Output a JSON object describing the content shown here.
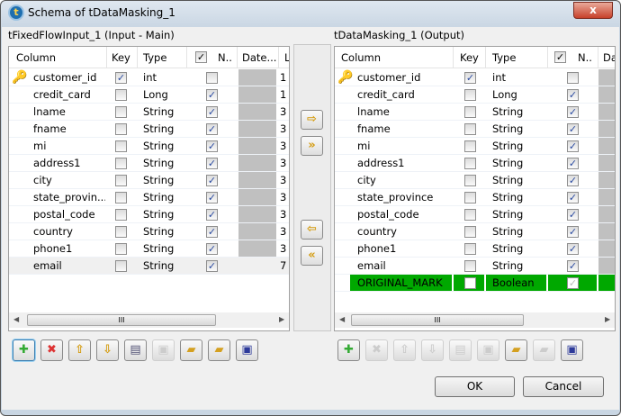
{
  "window": {
    "title": "Schema of tDataMasking_1",
    "close": "x"
  },
  "input": {
    "label": "tFixedFlowInput_1 (Input - Main)",
    "headers": {
      "column": "Column",
      "key": "Key",
      "type": "Type",
      "nullable": "N..",
      "date": "Date...",
      "length": "L"
    },
    "rows": [
      {
        "name": "customer_id",
        "key": true,
        "type": "int",
        "nullable": false,
        "length": "1"
      },
      {
        "name": "credit_card",
        "key": false,
        "type": "Long",
        "nullable": true,
        "length": "1"
      },
      {
        "name": "lname",
        "key": false,
        "type": "String",
        "nullable": true,
        "length": "3"
      },
      {
        "name": "fname",
        "key": false,
        "type": "String",
        "nullable": true,
        "length": "3"
      },
      {
        "name": "mi",
        "key": false,
        "type": "String",
        "nullable": true,
        "length": "3"
      },
      {
        "name": "address1",
        "key": false,
        "type": "String",
        "nullable": true,
        "length": "3"
      },
      {
        "name": "city",
        "key": false,
        "type": "String",
        "nullable": true,
        "length": "3"
      },
      {
        "name": "state_provin...",
        "key": false,
        "type": "String",
        "nullable": true,
        "length": "3"
      },
      {
        "name": "postal_code",
        "key": false,
        "type": "String",
        "nullable": true,
        "length": "3"
      },
      {
        "name": "country",
        "key": false,
        "type": "String",
        "nullable": true,
        "length": "3"
      },
      {
        "name": "phone1",
        "key": false,
        "type": "String",
        "nullable": true,
        "length": "3"
      },
      {
        "name": "email",
        "key": false,
        "type": "String",
        "nullable": true,
        "length": "7",
        "selected": true
      }
    ]
  },
  "output": {
    "label": "tDataMasking_1 (Output)",
    "headers": {
      "column": "Column",
      "key": "Key",
      "type": "Type",
      "nullable": "N..",
      "date": "Da"
    },
    "rows": [
      {
        "name": "customer_id",
        "key": true,
        "type": "int",
        "nullable": false
      },
      {
        "name": "credit_card",
        "key": false,
        "type": "Long",
        "nullable": true
      },
      {
        "name": "lname",
        "key": false,
        "type": "String",
        "nullable": true
      },
      {
        "name": "fname",
        "key": false,
        "type": "String",
        "nullable": true
      },
      {
        "name": "mi",
        "key": false,
        "type": "String",
        "nullable": true
      },
      {
        "name": "address1",
        "key": false,
        "type": "String",
        "nullable": true
      },
      {
        "name": "city",
        "key": false,
        "type": "String",
        "nullable": true
      },
      {
        "name": "state_province",
        "key": false,
        "type": "String",
        "nullable": true
      },
      {
        "name": "postal_code",
        "key": false,
        "type": "String",
        "nullable": true
      },
      {
        "name": "country",
        "key": false,
        "type": "String",
        "nullable": true
      },
      {
        "name": "phone1",
        "key": false,
        "type": "String",
        "nullable": true
      },
      {
        "name": "email",
        "key": false,
        "type": "String",
        "nullable": true
      },
      {
        "name": "ORIGINAL_MARK",
        "key": false,
        "type": "Boolean",
        "nullable": true,
        "highlight": true
      }
    ]
  },
  "colors": {
    "highlight": "#00a800",
    "arrow": "#d49b0e"
  },
  "buttons": {
    "ok": "OK",
    "cancel": "Cancel"
  }
}
